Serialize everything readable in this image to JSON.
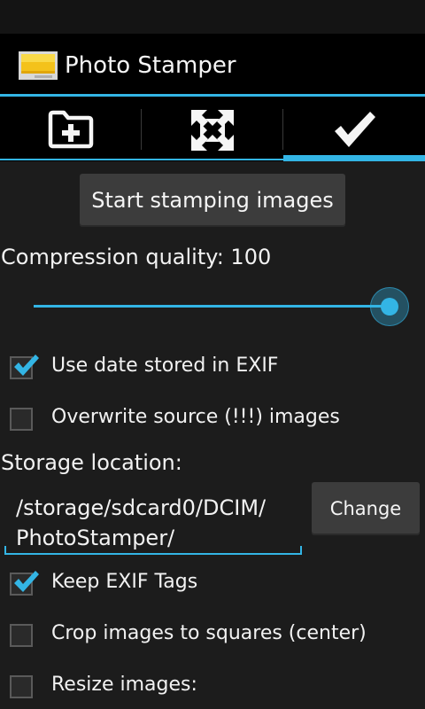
{
  "app": {
    "title": "Photo Stamper"
  },
  "tabs": [
    {
      "icon": "folder-add-icon",
      "selected": false
    },
    {
      "icon": "fullscreen-icon",
      "selected": false
    },
    {
      "icon": "checkmark-icon",
      "selected": true
    }
  ],
  "start_button": {
    "label": "Start stamping images"
  },
  "compression": {
    "label": "Compression quality: 100",
    "value": 100,
    "max": 100
  },
  "options": [
    {
      "label": "Use date stored in EXIF",
      "checked": true
    },
    {
      "label": "Overwrite source (!!!) images",
      "checked": false
    }
  ],
  "storage": {
    "label": "Storage location:",
    "path_line1": "/storage/sdcard0/DCIM/",
    "path_line2": "PhotoStamper/",
    "change_label": "Change"
  },
  "options2": [
    {
      "label": "Keep EXIF Tags",
      "checked": true
    },
    {
      "label": "Crop images to squares (center)",
      "checked": false
    },
    {
      "label": "Resize images:",
      "checked": false
    }
  ],
  "colors": {
    "accent": "#33b5e5",
    "background": "#1c1c1c",
    "button": "#3c3c3c"
  }
}
